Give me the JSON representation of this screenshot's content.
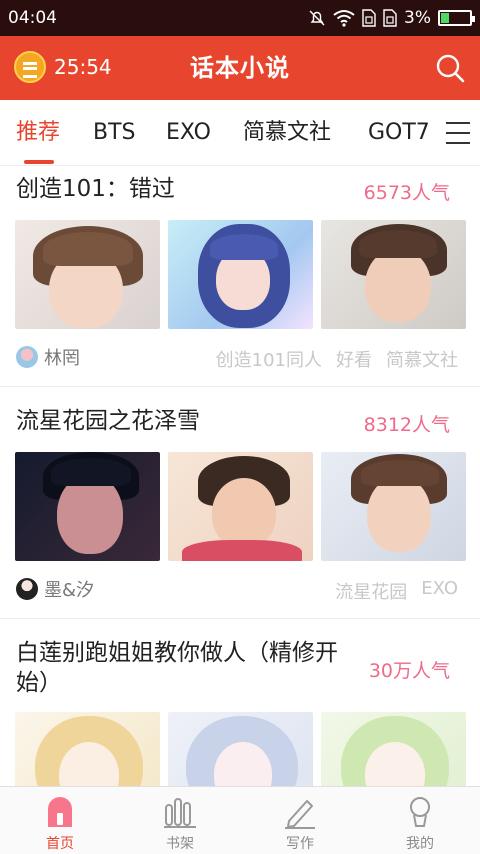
{
  "status_bar": {
    "time": "04:04",
    "battery": "3%",
    "battery_level": 0.03
  },
  "header": {
    "timer": "25:54",
    "title": "话本小说",
    "accent": "#e8452e"
  },
  "tabs": [
    {
      "label": "推荐",
      "active": true
    },
    {
      "label": "BTS"
    },
    {
      "label": "EXO"
    },
    {
      "label": "简慕文社"
    },
    {
      "label": "GOT7"
    }
  ],
  "stories": [
    {
      "title": "创造101：错过",
      "popularity": "6573人气",
      "author": "林罔",
      "tags": [
        "创造101同人",
        "好看",
        "简慕文社"
      ]
    },
    {
      "title": "流星花园之花泽雪",
      "popularity": "8312人气",
      "author": "墨&汐",
      "tags": [
        "流星花园",
        "EXO"
      ]
    },
    {
      "title": "白莲别跑姐姐教你做人（精修开始）",
      "popularity": "30万人气",
      "author": "",
      "tags": []
    }
  ],
  "bottom_nav": [
    {
      "label": "首页",
      "icon": "home-icon",
      "active": true
    },
    {
      "label": "书架",
      "icon": "bookshelf-icon"
    },
    {
      "label": "写作",
      "icon": "pen-icon"
    },
    {
      "label": "我的",
      "icon": "profile-icon"
    }
  ]
}
